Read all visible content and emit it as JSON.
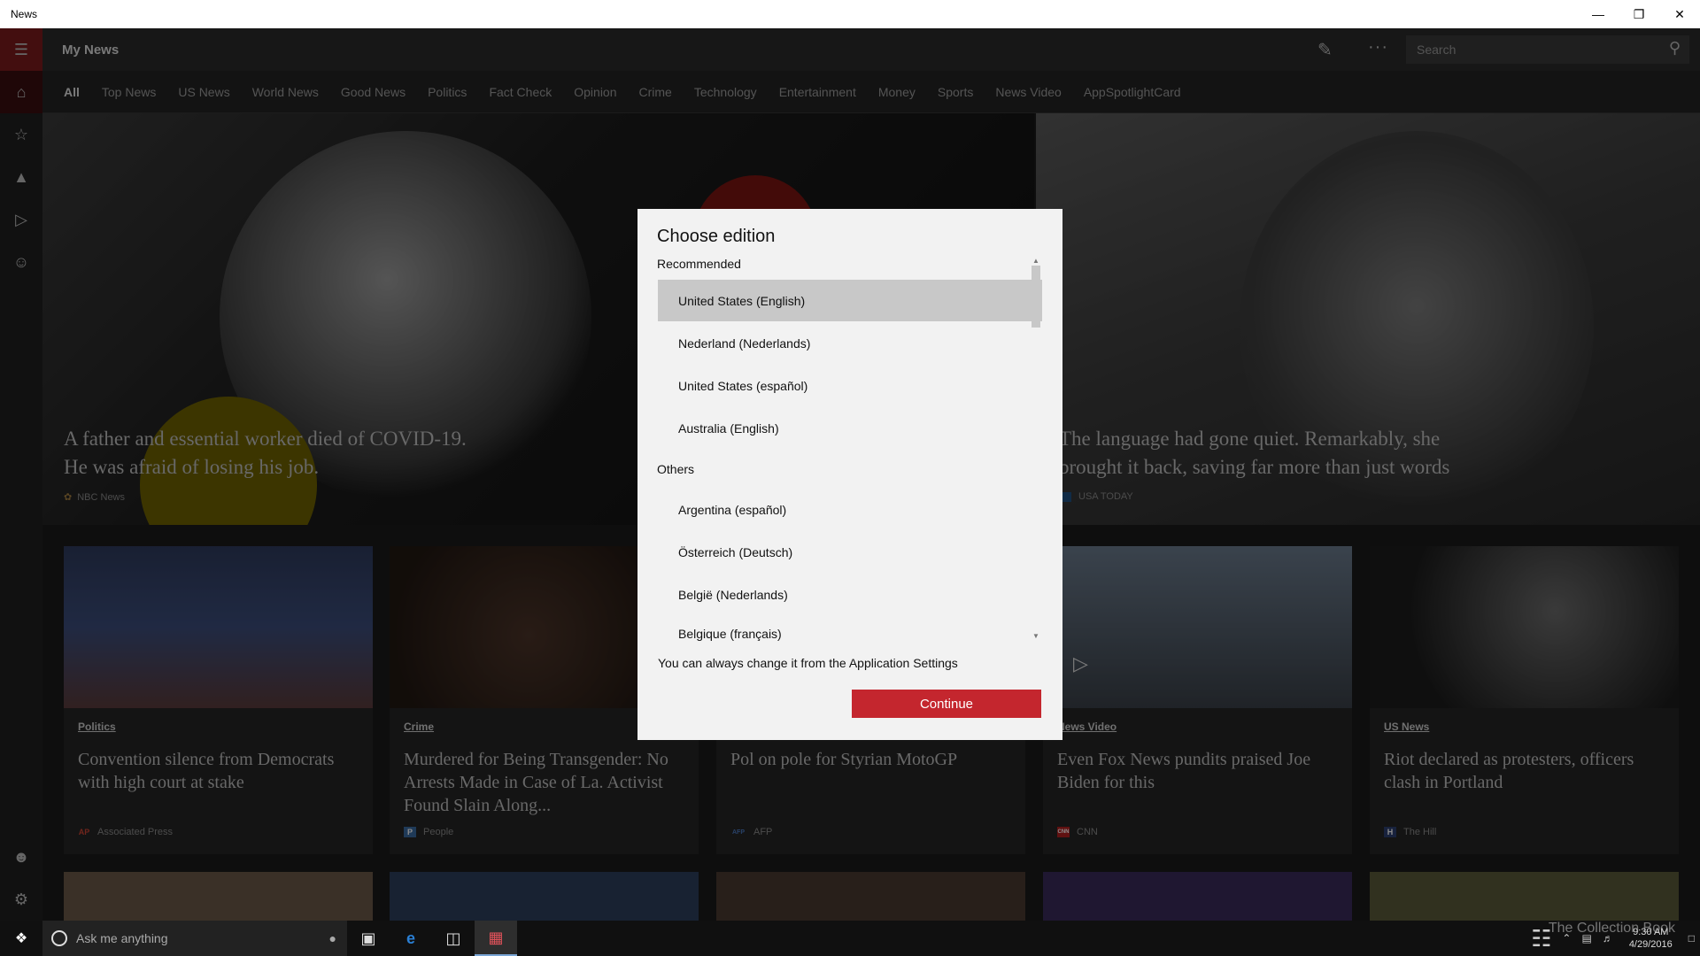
{
  "window": {
    "title": "News"
  },
  "header": {
    "title": "My News",
    "search_placeholder": "Search"
  },
  "tabs": [
    {
      "label": "All",
      "active": true
    },
    {
      "label": "Top News"
    },
    {
      "label": "US News"
    },
    {
      "label": "World News"
    },
    {
      "label": "Good News"
    },
    {
      "label": "Politics"
    },
    {
      "label": "Fact Check"
    },
    {
      "label": "Opinion"
    },
    {
      "label": "Crime"
    },
    {
      "label": "Technology"
    },
    {
      "label": "Entertainment"
    },
    {
      "label": "Money"
    },
    {
      "label": "Sports"
    },
    {
      "label": "News Video"
    },
    {
      "label": "AppSpotlightCard"
    }
  ],
  "hero": [
    {
      "headline_line1": "A father and essential worker died of COVID-19.",
      "headline_line2": "He was afraid of losing his job.",
      "source": "NBC News"
    },
    {
      "headline_line1": "The language had gone quiet. Remarkably, she",
      "headline_line2": "brought it back, saving far more than just words",
      "source": "USA TODAY"
    }
  ],
  "cards": [
    {
      "category": "Politics",
      "headline": "Convention silence from Democrats with high court at stake",
      "source": "Associated Press",
      "logo": "AP"
    },
    {
      "category": "Crime",
      "headline": "Murdered for Being Transgender: No Arrests Made in Case of La. Activist Found Slain Along...",
      "source": "People",
      "logo": "P"
    },
    {
      "category": "",
      "headline": "Pol on pole for Styrian MotoGP",
      "source": "AFP",
      "logo": "AFP"
    },
    {
      "category": "News Video",
      "headline": "Even Fox News pundits praised Joe Biden for this",
      "source": "CNN",
      "logo": "CNN"
    },
    {
      "category": "US News",
      "headline": "Riot declared as protesters, officers clash in Portland",
      "source": "The Hill",
      "logo": "H"
    }
  ],
  "dialog": {
    "title": "Choose edition",
    "recommended_label": "Recommended",
    "recommended": [
      "United States (English)",
      "Nederland (Nederlands)",
      "United States (español)",
      "Australia (English)"
    ],
    "others_label": "Others",
    "others": [
      "Argentina (español)",
      "Österreich (Deutsch)",
      "België (Nederlands)",
      "Belgique (français)"
    ],
    "selected": "United States (English)",
    "note": "You can always change it from the Application Settings",
    "continue_label": "Continue"
  },
  "taskbar": {
    "cortana_placeholder": "Ask me anything",
    "time": "9:30 AM",
    "date": "4/29/2016",
    "watermark": "The Collection Book"
  },
  "colors": {
    "accent": "#c4262e",
    "rail_accent": "#7a1a1d"
  }
}
